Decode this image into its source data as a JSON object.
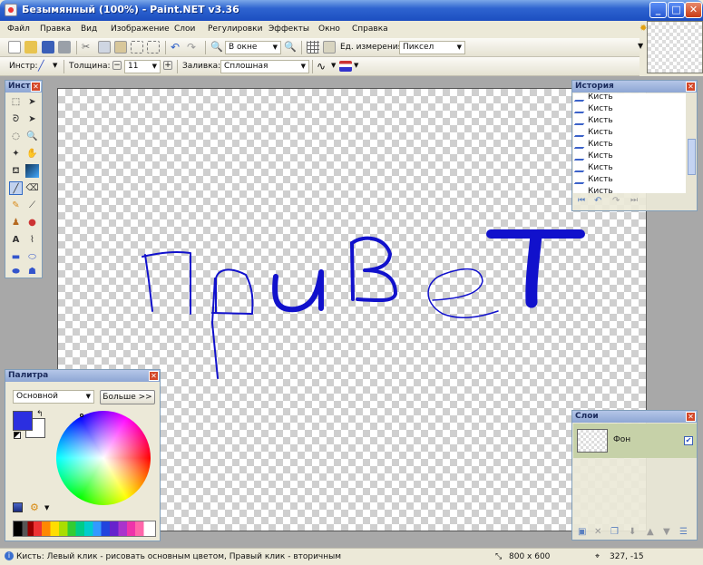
{
  "window": {
    "title": "Безымянный (100%) - Paint.NET v3.36",
    "minimize": "_",
    "maximize": "□",
    "close": "✕"
  },
  "menu": [
    "Файл",
    "Правка",
    "Вид",
    "Изображение",
    "Слои",
    "Регулировки",
    "Эффекты",
    "Окно",
    "Справка"
  ],
  "toolbar1": {
    "zoom_value": "В окне",
    "units_label": "Ед. измерения:",
    "units_value": "Пиксел"
  },
  "toolbar2": {
    "tool_label": "Инстр:",
    "width_label": "Толщина:",
    "width_value": "11",
    "fill_label": "Заливка:",
    "fill_value": "Сплошная"
  },
  "tools_panel": {
    "title": "Инст",
    "close": "✕"
  },
  "history_panel": {
    "title": "История",
    "close": "✕",
    "items": [
      "Кисть",
      "Кисть",
      "Кисть",
      "Кисть",
      "Кисть",
      "Кисть",
      "Кисть",
      "Кисть",
      "Кисть"
    ]
  },
  "palette_panel": {
    "title": "Палитра",
    "close": "✕",
    "mode_value": "Основной",
    "more_button": "Больше >>"
  },
  "layers_panel": {
    "title": "Слои",
    "close": "✕",
    "layer_name": "Фон"
  },
  "status": {
    "hint": "Кисть: Левый клик - рисовать основным цветом, Правый клик - вторичным",
    "image_size": "800 x 600",
    "cursor_pos": "327, -15"
  },
  "colors": {
    "primary": "#2b2fe0",
    "secondary": "#ffffff",
    "stroke": "#1010d0"
  },
  "canvas_text": "ПриВеТ"
}
